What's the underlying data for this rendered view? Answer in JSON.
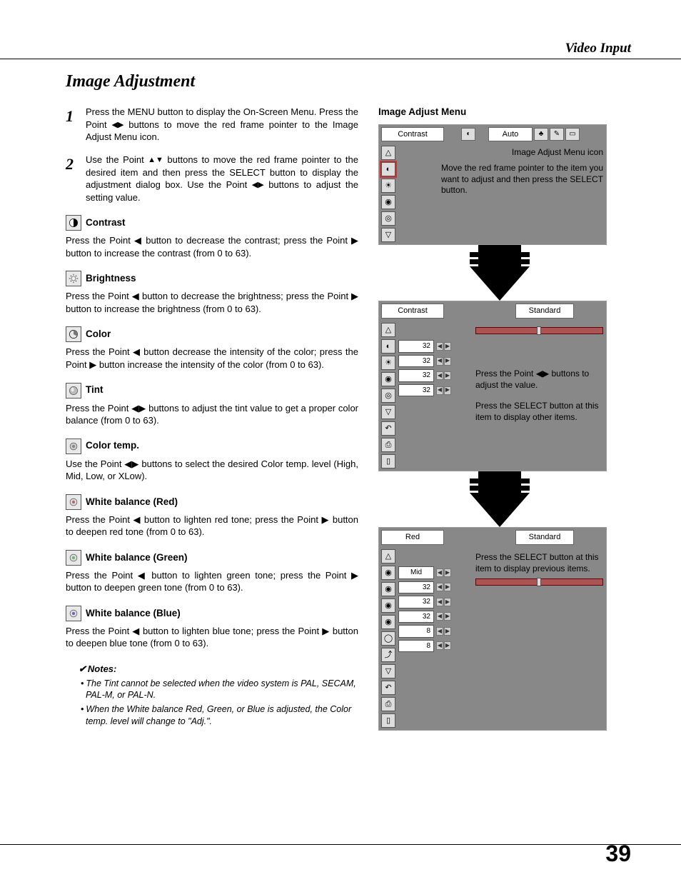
{
  "header": "Video Input",
  "pageNumber": "39",
  "title": "Image Adjustment",
  "steps": [
    {
      "num": "1",
      "text_a": "Press the MENU button to display the On-Screen Menu.  Press the Point ",
      "text_b": " buttons to move the red frame pointer to the Image Adjust Menu icon."
    },
    {
      "num": "2",
      "text_a": "Use the Point ",
      "text_b": " buttons to move the red frame pointer to the desired item and then press the SELECT button to display the adjustment dialog box. Use the Point ",
      "text_c": " buttons to adjust the setting value."
    }
  ],
  "items": [
    {
      "title": "Contrast",
      "text": "Press the Point ◀ button to decrease the contrast; press the Point ▶ button to increase the contrast (from 0 to 63)."
    },
    {
      "title": "Brightness",
      "text": "Press the Point ◀ button to decrease the brightness; press the Point ▶ button to increase the brightness (from 0 to 63)."
    },
    {
      "title": "Color",
      "text": "Press the Point ◀ button decrease the intensity of the color; press the Point ▶ button increase the intensity of the color (from 0 to 63)."
    },
    {
      "title": "Tint",
      "text": "Press the Point ◀▶ buttons to adjust the tint value to get a proper color balance (from 0 to 63)."
    },
    {
      "title": "Color temp.",
      "text": "Use the Point ◀▶ buttons to select the desired Color temp. level (High, Mid, Low, or XLow)."
    },
    {
      "title": "White balance (Red)",
      "text": "Press the Point ◀ button to lighten red tone; press the Point ▶ button to deepen red tone (from 0 to 63)."
    },
    {
      "title": "White balance (Green)",
      "text": "Press the Point ◀ button to lighten green tone; press the Point ▶ button to deepen green tone (from 0 to 63)."
    },
    {
      "title": "White balance (Blue)",
      "text": "Press the Point ◀ button to lighten blue tone; press the Point ▶ button to deepen blue tone (from 0 to 63)."
    }
  ],
  "notesHead": "Notes:",
  "notes": [
    "The Tint cannot be selected when the video system is PAL, SECAM, PAL-M, or PAL-N.",
    "When the White balance Red, Green, or Blue is adjusted, the Color temp. level will change to \"Adj.\"."
  ],
  "menu": {
    "heading": "Image Adjust Menu",
    "panel1": {
      "topLabel": "Contrast",
      "autoLabel": "Auto",
      "iconCallout": "Image Adjust Menu icon",
      "mainCallout": "Move the red frame pointer to the item you want to adjust and then press the SELECT button."
    },
    "panel2": {
      "topLabel": "Contrast",
      "modeLabel": "Standard",
      "values": [
        "32",
        "32",
        "32",
        "32"
      ],
      "callout1": "Press the Point ◀▶ buttons to adjust the value.",
      "callout2": "Press the SELECT button at this item to display other items."
    },
    "panel3": {
      "topLabel": "Red",
      "modeLabel": "Standard",
      "row1": "Mid",
      "values": [
        "32",
        "32",
        "32",
        "8",
        "8"
      ],
      "callout1": "Press the SELECT button at this item to display previous items."
    }
  }
}
